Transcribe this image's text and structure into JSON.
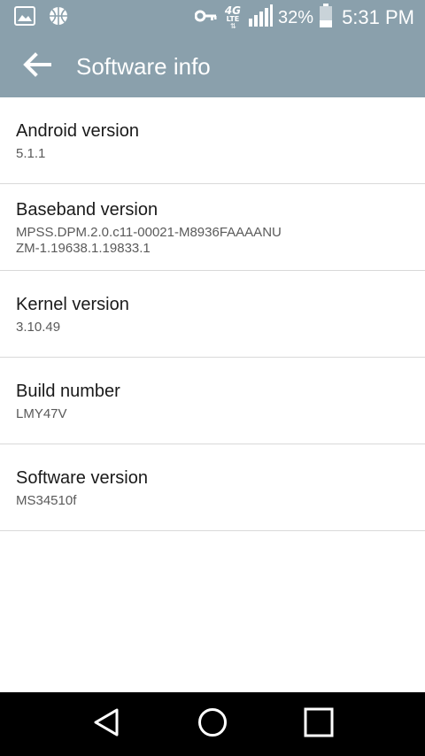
{
  "status_bar": {
    "icons": [
      "image-icon",
      "basketball-icon",
      "vpn-key-icon",
      "network-4g-lte-icon",
      "signal-icon",
      "battery-icon"
    ],
    "network_top": "4G",
    "network_bottom": "LTE",
    "battery_percent": "32%",
    "time": "5:31 PM"
  },
  "app_bar": {
    "title": "Software info",
    "back_icon": "arrow-left-icon"
  },
  "items": [
    {
      "title": "Android version",
      "value": "5.1.1"
    },
    {
      "title": "Baseband version",
      "value": "MPSS.DPM.2.0.c11-00021-M8936FAAAANUZM-1.19638.1.19833.1"
    },
    {
      "title": "Kernel version",
      "value": "3.10.49"
    },
    {
      "title": "Build number",
      "value": "LMY47V"
    },
    {
      "title": "Software version",
      "value": "MS34510f"
    }
  ],
  "nav_bar": {
    "icons": [
      "back-triangle-icon",
      "home-circle-icon",
      "recents-square-icon"
    ]
  },
  "colors": {
    "app_bar": "#8aa0ac",
    "nav_bar": "#000000",
    "divider": "#d9d9d9"
  }
}
